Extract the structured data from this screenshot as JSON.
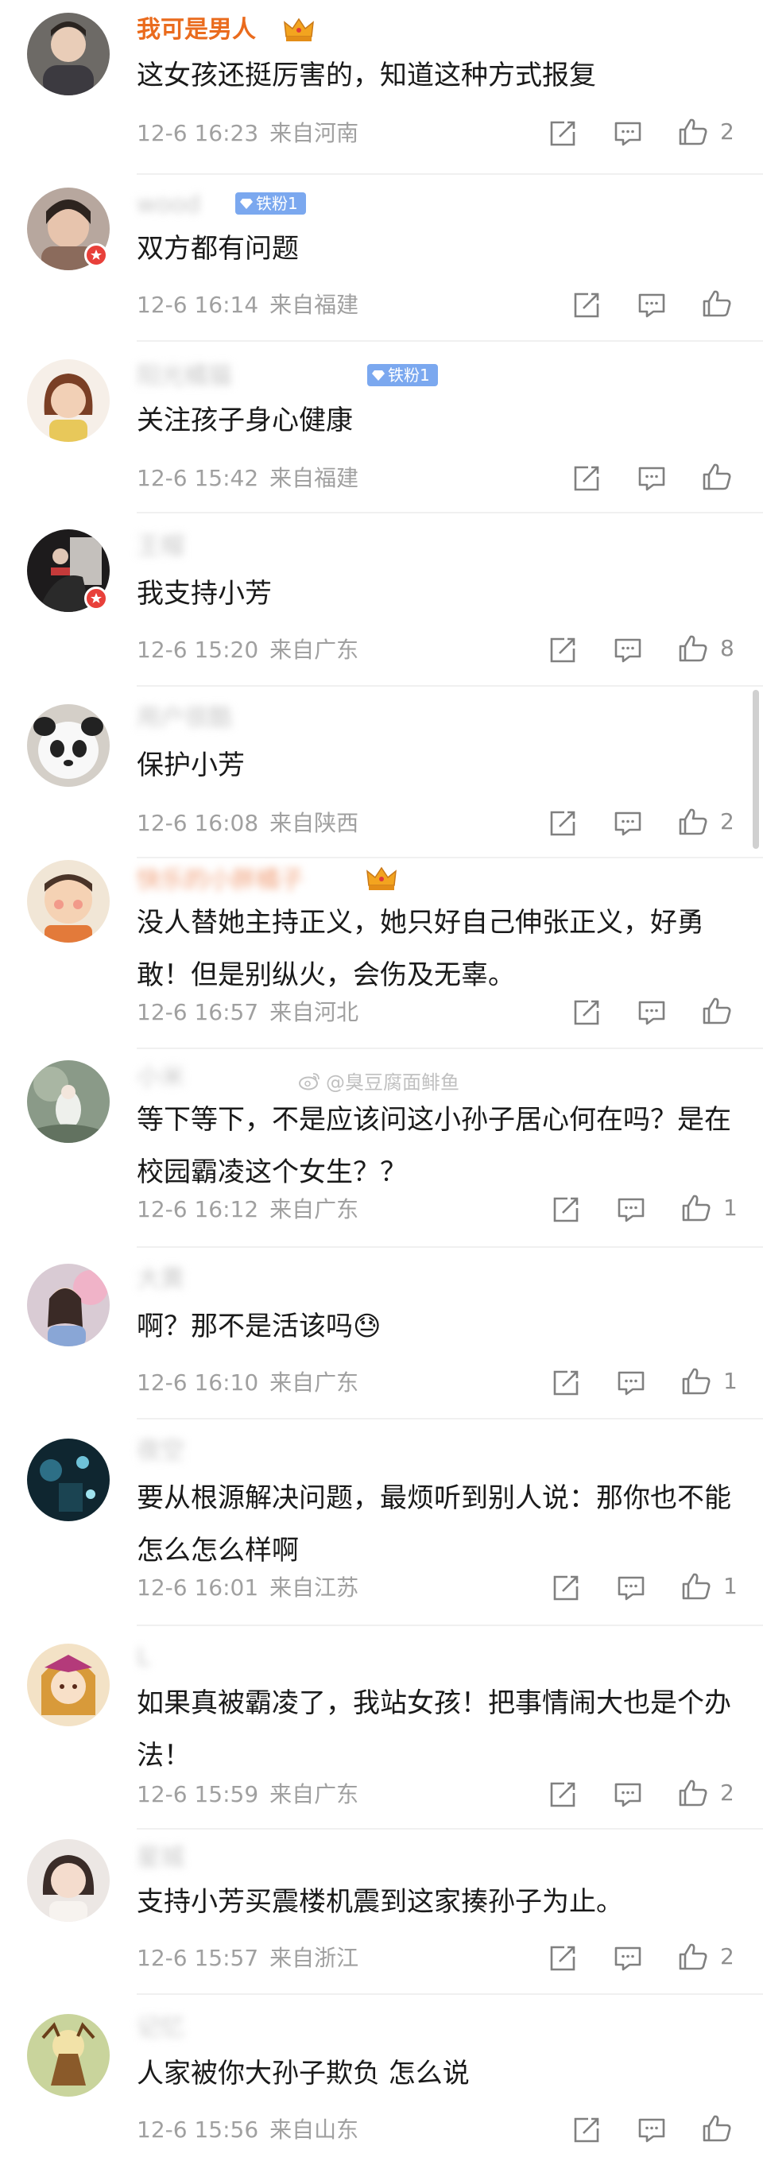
{
  "comments": [
    {
      "username": "我可是男人",
      "vip": true,
      "content": "这女孩还挺厉害的，知道这种方式报复",
      "date": "12-6 16:23",
      "location": "来自河南",
      "likes": "2"
    },
    {
      "username": "wood",
      "content": "双方都有问题",
      "date": "12-6 16:14",
      "location": "来自福建",
      "likes": "",
      "fan_badge": "铁粉1"
    },
    {
      "username": "阳光橘猫",
      "content": "关注孩子身心健康",
      "date": "12-6 15:42",
      "location": "来自福建",
      "likes": "",
      "fan_badge": "铁粉1"
    },
    {
      "username": "王帽",
      "content": "我支持小芳",
      "date": "12-6 15:20",
      "location": "来自广东",
      "likes": "8"
    },
    {
      "username": "用户很酷",
      "content": "保护小芳",
      "date": "12-6 16:08",
      "location": "来自陕西",
      "likes": "2"
    },
    {
      "username": "快乐的小胖橘子",
      "content": "没人替她主持正义，她只好自己伸张正义，好勇敢！但是别纵火，会伤及无辜。",
      "date": "12-6 16:57",
      "location": "来自河北",
      "likes": ""
    },
    {
      "username": "小米",
      "content": "等下等下，不是应该问这小孙子居心何在吗？是在校园霸凌这个女生？？",
      "date": "12-6 16:12",
      "location": "来自广东",
      "likes": "1"
    },
    {
      "username": "大黄",
      "content": "啊？那不是活该吗😓",
      "date": "12-6 16:10",
      "location": "来自广东",
      "likes": "1"
    },
    {
      "username": "夜空",
      "content": "要从根源解决问题，最烦听到别人说：那你也不能怎么怎么样啊",
      "date": "12-6 16:01",
      "location": "来自江苏",
      "likes": "1"
    },
    {
      "username": "L",
      "content": "如果真被霸凌了，我站女孩！把事情闹大也是个办法！",
      "date": "12-6 15:59",
      "location": "来自广东",
      "likes": "2"
    },
    {
      "username": "星城",
      "content": "支持小芳买震楼机震到这家揍孙子为止。",
      "date": "12-6 15:57",
      "location": "来自浙江",
      "likes": "2"
    },
    {
      "username": "记忆",
      "content": "人家被你大孙子欺负 怎么说",
      "date": "12-6 15:56",
      "location": "来自山东",
      "likes": ""
    }
  ],
  "watermark": "@臭豆腐面鲱鱼",
  "colors": {
    "vip_name": "#ea6b1d",
    "fan_badge": "#7ba8ef",
    "meta": "#a0a0a0",
    "verified_badge": "#e8403a"
  },
  "icons": [
    "share-icon",
    "comment-icon",
    "like-icon",
    "crown-icon",
    "diamond-icon",
    "weibo-logo-icon"
  ]
}
